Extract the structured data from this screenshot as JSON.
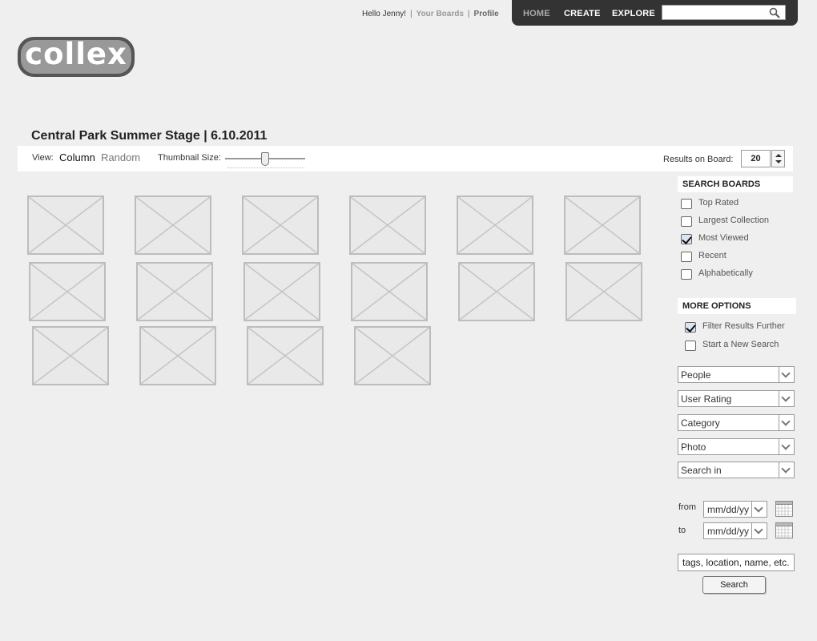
{
  "topbar": {
    "greeting": "Hello Jenny!",
    "separator": "|",
    "your_boards": "Your Boards",
    "profile": "Profile"
  },
  "nav": {
    "home": "HOME",
    "create": "CREATE",
    "explore": "EXPLORE",
    "search_placeholder": "",
    "search_icon": "magnifier-icon"
  },
  "logo": {
    "text": "collex"
  },
  "board": {
    "title": "Central Park Summer Stage  |  6.10.2011"
  },
  "viewbar": {
    "view_label": "View:",
    "column": "Column",
    "random": "Random",
    "thumbnail_label": "Thumbnail Size:",
    "thumbnail_level": 0.5,
    "results_label": "Results on Board:",
    "results_value": "20"
  },
  "thumbnails": {
    "count": 16,
    "icon": "image-placeholder-icon"
  },
  "search_boards": {
    "heading": "SEARCH BOARDS",
    "options": [
      {
        "label": "Top Rated",
        "checked": false
      },
      {
        "label": "Largest Collection",
        "checked": false
      },
      {
        "label": "Most Viewed",
        "checked": true
      },
      {
        "label": "Recent",
        "checked": false
      },
      {
        "label": "Alphabetically",
        "checked": false
      }
    ]
  },
  "more_options": {
    "heading": "MORE OPTIONS",
    "options": [
      {
        "label": "Filter Results Further",
        "checked": true
      },
      {
        "label": "Start a New Search",
        "checked": false
      }
    ]
  },
  "filters": [
    "People",
    "User Rating",
    "Category",
    "Photo",
    "Search in"
  ],
  "date_range": {
    "from_label": "from",
    "to_label": "to",
    "from_value": "mm/dd/yy",
    "to_value": "mm/dd/yy",
    "calendar_icon": "calendar-icon"
  },
  "tags_search": {
    "value": "tags, location, name, etc.",
    "button": "Search"
  }
}
